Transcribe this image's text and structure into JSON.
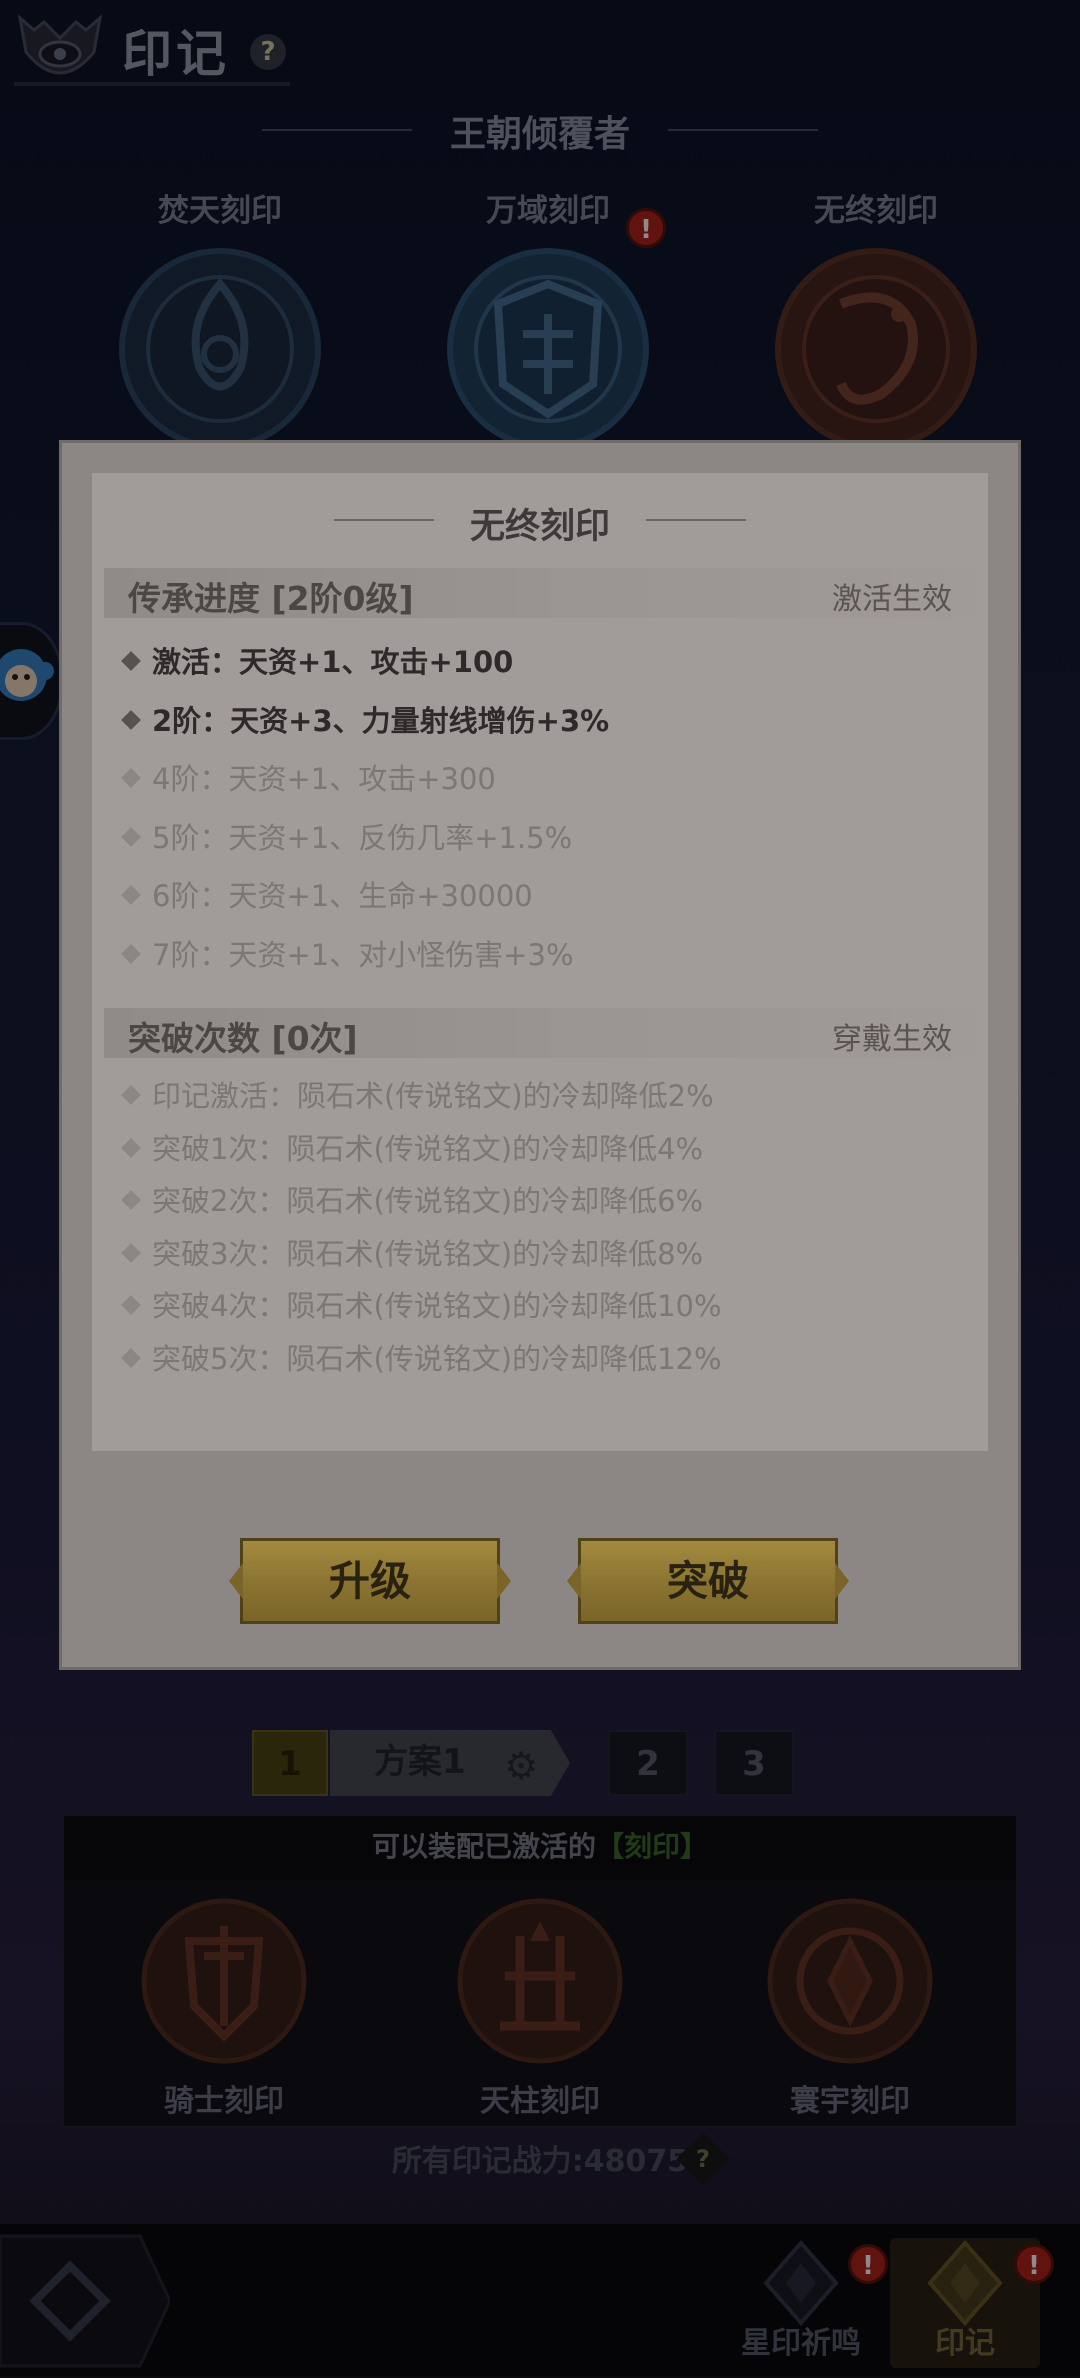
{
  "header": {
    "title": "印记",
    "help": "?"
  },
  "dynasty": {
    "title": "王朝倾覆者"
  },
  "seals": [
    {
      "name": "焚天刻印",
      "alert": false
    },
    {
      "name": "万域刻印",
      "alert": true
    },
    {
      "name": "无终刻印",
      "alert": false
    }
  ],
  "alert_mark": "!",
  "popup": {
    "title": "无终刻印",
    "inherit": {
      "title": "传承进度 [2阶0级]",
      "effect": "激活生效",
      "lines": [
        {
          "text": "激活：天资+1、攻击+100",
          "active": true
        },
        {
          "text": "2阶：天资+3、力量射线增伤+3%",
          "active": true
        },
        {
          "text": "4阶：天资+1、攻击+300",
          "active": false
        },
        {
          "text": "5阶：天资+1、反伤几率+1.5%",
          "active": false
        },
        {
          "text": "6阶：天资+1、生命+30000",
          "active": false
        },
        {
          "text": "7阶：天资+1、对小怪伤害+3%",
          "active": false
        }
      ]
    },
    "breakthrough": {
      "title": "突破次数 [0次]",
      "effect": "穿戴生效",
      "lines": [
        {
          "text": "印记激活：陨石术(传说铭文)的冷却降低2%"
        },
        {
          "text": "突破1次：陨石术(传说铭文)的冷却降低4%"
        },
        {
          "text": "突破2次：陨石术(传说铭文)的冷却降低6%"
        },
        {
          "text": "突破3次：陨石术(传说铭文)的冷却降低8%"
        },
        {
          "text": "突破4次：陨石术(传说铭文)的冷却降低10%"
        },
        {
          "text": "突破5次：陨石术(传说铭文)的冷却降低12%"
        }
      ]
    },
    "buttons": {
      "upgrade": "升级",
      "breakthrough": "突破"
    }
  },
  "plans": {
    "tab1_num": "1",
    "tab1_name": "方案1",
    "tab2": "2",
    "tab3": "3"
  },
  "equip": {
    "header_prefix": "可以装配已激活的",
    "header_highlight": "【刻印】",
    "items": [
      "骑士刻印",
      "天柱刻印",
      "寰宇刻印"
    ]
  },
  "power": {
    "text": "所有印记战力:48075",
    "help": "?"
  },
  "nav": [
    {
      "label": "星印祈鸣",
      "alert": true
    },
    {
      "label": "印记",
      "alert": true
    }
  ],
  "colors": {
    "popup": "#a19b99",
    "gold_button": "#a38a3f",
    "highlight_green": "#3d6b2a",
    "alert_red": "#b1261c"
  }
}
